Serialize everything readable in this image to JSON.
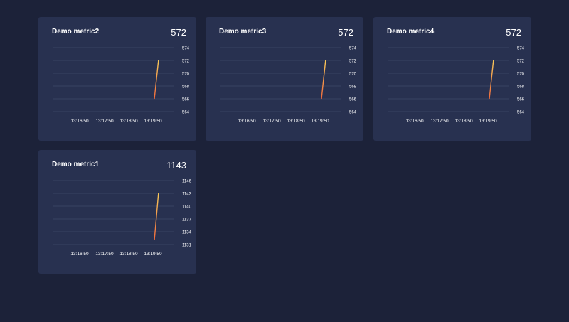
{
  "chart_data": [
    {
      "type": "line",
      "title": "Demo metric2",
      "current_value": "572",
      "x_ticks": [
        "13:16:50",
        "13:17:50",
        "13:18:50",
        "13:19:50"
      ],
      "y_ticks": [
        564,
        566,
        568,
        570,
        572,
        574
      ],
      "ylim": [
        564,
        574
      ],
      "series": [
        {
          "x": [
            "13:19:50",
            "13:20:00"
          ],
          "values": [
            566,
            572
          ]
        }
      ],
      "grid": true
    },
    {
      "type": "line",
      "title": "Demo metric3",
      "current_value": "572",
      "x_ticks": [
        "13:16:50",
        "13:17:50",
        "13:18:50",
        "13:19:50"
      ],
      "y_ticks": [
        564,
        566,
        568,
        570,
        572,
        574
      ],
      "ylim": [
        564,
        574
      ],
      "series": [
        {
          "x": [
            "13:19:50",
            "13:20:00"
          ],
          "values": [
            566,
            572
          ]
        }
      ],
      "grid": true
    },
    {
      "type": "line",
      "title": "Demo metric4",
      "current_value": "572",
      "x_ticks": [
        "13:16:50",
        "13:17:50",
        "13:18:50",
        "13:19:50"
      ],
      "y_ticks": [
        564,
        566,
        568,
        570,
        572,
        574
      ],
      "ylim": [
        564,
        574
      ],
      "series": [
        {
          "x": [
            "13:19:50",
            "13:20:00"
          ],
          "values": [
            566,
            572
          ]
        }
      ],
      "grid": true
    },
    {
      "type": "line",
      "title": "Demo metric1",
      "current_value": "1143",
      "x_ticks": [
        "13:16:50",
        "13:17:50",
        "13:18:50",
        "13:19:50"
      ],
      "y_ticks": [
        1131,
        1134,
        1137,
        1140,
        1143,
        1146
      ],
      "ylim": [
        1131,
        1146
      ],
      "series": [
        {
          "x": [
            "13:19:50",
            "13:20:00"
          ],
          "values": [
            1132,
            1143
          ]
        }
      ],
      "grid": true
    }
  ],
  "colors": {
    "background": "#1c2239",
    "card": "#283150",
    "grid": "#3d4868",
    "line_start": "#f06a3c",
    "line_end": "#f7c85a",
    "text": "#ffffff"
  }
}
